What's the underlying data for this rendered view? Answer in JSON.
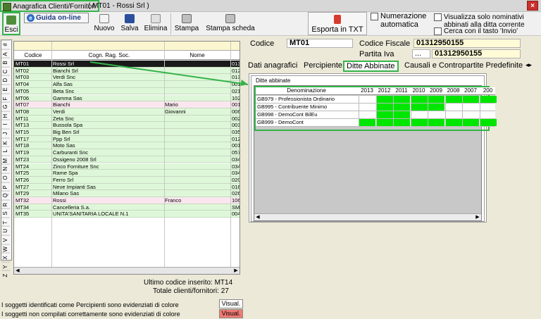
{
  "window": {
    "title_main": "Anagrafica Clienti/Fornitori",
    "title_rest": "( MT01 - Rossi Srl  )",
    "close": "×"
  },
  "toolbar": {
    "esci": "Esci",
    "guida": "Guida on-line",
    "nuovo": "Nuovo",
    "salva": "Salva",
    "elimina": "Elimina",
    "stampa": "Stampa",
    "stampa_scheda": "Stampa scheda",
    "esporta": "Esporta in TXT",
    "num_auto_1": "Numerazione",
    "num_auto_2": "automatica",
    "vis_1": "Visualizza solo nominativi",
    "vis_2": "abbinati alla ditta corrente",
    "cerca": "Cerca con il tasto 'Invio'"
  },
  "alpha_index": [
    "#",
    "A",
    "B",
    "C",
    "D",
    "E",
    "F",
    "G",
    "H",
    "I",
    "J",
    "K",
    "L",
    "M",
    "N",
    "O",
    "P",
    "Q",
    "R",
    "S",
    "T",
    "U",
    "V",
    "W",
    "X",
    "Y",
    "Z"
  ],
  "grid": {
    "columns": [
      "Codice",
      "Cogn. Rag. Soc.",
      "Nome",
      ""
    ],
    "rows": [
      {
        "code": "MT01",
        "name": "Rossi Srl",
        "first": "",
        "extra": "013",
        "style": "sel"
      },
      {
        "code": "MT02",
        "name": "Bianchi Srl",
        "first": "",
        "extra": "012",
        "style": ""
      },
      {
        "code": "MT03",
        "name": "Verdi Snc",
        "first": "",
        "extra": "013",
        "style": ""
      },
      {
        "code": "MT04",
        "name": "Alfa Sas",
        "first": "",
        "extra": "001",
        "style": ""
      },
      {
        "code": "MT05",
        "name": "Beta Snc",
        "first": "",
        "extra": "021",
        "style": ""
      },
      {
        "code": "MT06",
        "name": "Gamma Sas",
        "first": "",
        "extra": "102",
        "style": ""
      },
      {
        "code": "MT07",
        "name": "Bianchi",
        "first": "Mario",
        "extra": "001",
        "style": "pink"
      },
      {
        "code": "MT08",
        "name": "Verdi",
        "first": "Giovanni",
        "extra": "006",
        "style": ""
      },
      {
        "code": "MT11",
        "name": "Zeta Snc",
        "first": "",
        "extra": "002",
        "style": ""
      },
      {
        "code": "MT13",
        "name": "Bussola Spa",
        "first": "",
        "extra": "003",
        "style": ""
      },
      {
        "code": "MT15",
        "name": "Big Ben Srl",
        "first": "",
        "extra": "035",
        "style": ""
      },
      {
        "code": "MT17",
        "name": "Ppp Srl",
        "first": "",
        "extra": "012",
        "style": ""
      },
      {
        "code": "MT18",
        "name": "Moto Sas",
        "first": "",
        "extra": "001",
        "style": ""
      },
      {
        "code": "MT19",
        "name": "Carburanti Snc",
        "first": "",
        "extra": "057",
        "style": ""
      },
      {
        "code": "MT23",
        "name": "Ossigeno 2008 Srl",
        "first": "",
        "extra": "034",
        "style": ""
      },
      {
        "code": "MT24",
        "name": "Zinco Forniture Snc",
        "first": "",
        "extra": "034",
        "style": ""
      },
      {
        "code": "MT25",
        "name": "Rame Spa",
        "first": "",
        "extra": "034",
        "style": ""
      },
      {
        "code": "MT26",
        "name": "Ferro Srl",
        "first": "",
        "extra": "020",
        "style": ""
      },
      {
        "code": "MT27",
        "name": "Neve Impianti Sas",
        "first": "",
        "extra": "016",
        "style": ""
      },
      {
        "code": "MT29",
        "name": "Milano Sas",
        "first": "",
        "extra": "026",
        "style": ""
      },
      {
        "code": "MT32",
        "name": "Rossi",
        "first": "Franco",
        "extra": "106",
        "style": "pink"
      },
      {
        "code": "MT34",
        "name": "Cancelleria S.a.",
        "first": "",
        "extra": "SM",
        "style": ""
      },
      {
        "code": "MT35",
        "name": "UNITA'SANITARIA LOCALE N.1",
        "first": "",
        "extra": "004",
        "style": ""
      }
    ]
  },
  "info": {
    "ultimo": "Ultimo codice inserito: MT14",
    "totale": "Totale clienti/fornitori: 27",
    "legend1": "I soggetti identificati come Percipienti sono evidenziati di colore",
    "legend2": "I soggetti non compilati correttamente sono evidenziati di colore",
    "visual": "Visual."
  },
  "detail": {
    "codice_label": "Codice",
    "codice": "MT01",
    "cf_label": "Codice Fiscale",
    "cf": "01312950155",
    "pi_label": "Partita Iva",
    "pi_btn": "...",
    "pi": "01312950155"
  },
  "tabs": [
    "Dati anagrafici",
    "Percipiente",
    "Ditte Abbinate",
    "Causali e Contropartite Predefinite"
  ],
  "ditte": {
    "legend": "Ditte abbinate",
    "header": "Denominazione",
    "years": [
      "2013",
      "2012",
      "2011",
      "2010",
      "2009",
      "2008",
      "2007",
      "200"
    ],
    "rows": [
      {
        "name": "GB979 - Professionista Ordinario",
        "on": [
          false,
          true,
          true,
          true,
          true,
          true,
          true,
          true
        ]
      },
      {
        "name": "GB995 - Contribuente Minimo",
        "on": [
          false,
          true,
          true,
          true,
          true,
          false,
          false,
          false
        ]
      },
      {
        "name": "GB998 - DemoCont BilEu",
        "on": [
          false,
          true,
          true,
          false,
          false,
          false,
          false,
          false
        ]
      },
      {
        "name": "GB999 - DemoCont",
        "on": [
          true,
          true,
          true,
          true,
          true,
          true,
          true,
          true
        ]
      }
    ]
  },
  "colors": {
    "green_cell": "#00e600",
    "row_green": "#dff7d9",
    "row_pink": "#fbe6ef",
    "highlight": "#35b34a"
  }
}
